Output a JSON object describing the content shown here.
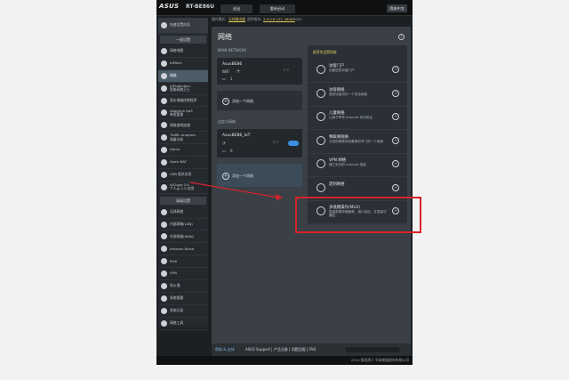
{
  "brand": {
    "logo": "ASUS",
    "model": "RT-BE86U"
  },
  "topbar": {
    "buttons": [
      "退出",
      "重新启动"
    ],
    "lang": "简体中文"
  },
  "infobar": {
    "op_mode_label": "操作模式:",
    "op_mode_value": "无线路由器",
    "fw_label": "固件版本:",
    "fw_value": "3.0.0.6.102_36067",
    "ssid_label": "SSID:"
  },
  "sidebar": {
    "quick": "快速设置向导",
    "general_header": "一般设置",
    "general_items": [
      {
        "label": "网络地图",
        "icon": "network-map-icon"
      },
      {
        "label": "AiMesh",
        "icon": "aimesh-icon"
      },
      {
        "label": "网络",
        "icon": "network-icon",
        "active": true
      },
      {
        "label": "AiProtection\n智能网络卫士",
        "icon": "shield-icon"
      },
      {
        "label": "家长电脑控制程序",
        "icon": "parental-icon"
      },
      {
        "label": "Adaptive QoS\n带宽管理",
        "icon": "qos-icon"
      },
      {
        "label": "网络游戏加速",
        "icon": "game-accel-icon"
      },
      {
        "label": "Traffic Analyzer\n流量分析",
        "icon": "traffic-icon"
      },
      {
        "label": "Game",
        "icon": "gamepad-icon"
      },
      {
        "label": "Open NAT",
        "icon": "nat-icon"
      },
      {
        "label": "USB 相关应用",
        "icon": "usb-icon"
      },
      {
        "label": "AiCloud 2.0\n个人云 2.0 应用",
        "icon": "cloud-icon"
      }
    ],
    "advanced_header": "高级设置",
    "advanced_items": [
      {
        "label": "无线网络",
        "icon": "wifi-icon"
      },
      {
        "label": "内部网络(LAN)",
        "icon": "lan-icon"
      },
      {
        "label": "外部网络(WAN)",
        "icon": "wan-icon"
      },
      {
        "label": "Amazon Alexa",
        "icon": "alexa-icon"
      },
      {
        "label": "IPv6",
        "icon": "ipv6-icon"
      },
      {
        "label": "VPN",
        "icon": "vpn-icon"
      },
      {
        "label": "防火墙",
        "icon": "firewall-icon"
      },
      {
        "label": "系统管理",
        "icon": "admin-icon"
      },
      {
        "label": "系统记录",
        "icon": "log-icon"
      },
      {
        "label": "网络工具",
        "icon": "tools-icon"
      }
    ]
  },
  "main": {
    "title": "网络",
    "section_main": "MAIN NETWORK",
    "main_card": {
      "name": "AsusBE86",
      "wifi_label": "WiFi",
      "devices": "1"
    },
    "add_label": "添加一个网络",
    "section_custom": "自定义网络",
    "iot_card": {
      "name": "AsusBE86_IoT",
      "devices": "0"
    },
    "add_label2": "添加一个网络",
    "right_header": "推荐的设置网络",
    "right_items": [
      {
        "title": "访客门户",
        "sub": "创建您的访客门户"
      },
      {
        "title": "访客网络",
        "sub": "提供访客另外一个安全网络"
      },
      {
        "title": "儿童网络",
        "sub": "让孩子享有 Internet 访问安全"
      },
      {
        "title": "物联网网络",
        "sub": "为您的物联网设备提供专门的一个网络"
      },
      {
        "title": "VPN 网络",
        "sub": "建立安全的 Internet 连接"
      },
      {
        "title": "定制网络",
        "sub": ""
      },
      {
        "title": "多链路操作(MLO)",
        "sub": "提高数据传输速率、减少延迟，并提高可靠性。"
      }
    ]
  },
  "bottombar": {
    "help": "帮助 & 支持",
    "links": "ASUS Support | 产品注册 | 问题回报 | FAQ"
  },
  "footer": {
    "copyright": "2024 版权属于 华硕电脑股份有限公司"
  },
  "colors": {
    "accent": "#e1c95c",
    "highlight": "#d8222a",
    "toggle": "#3c8fe0"
  }
}
